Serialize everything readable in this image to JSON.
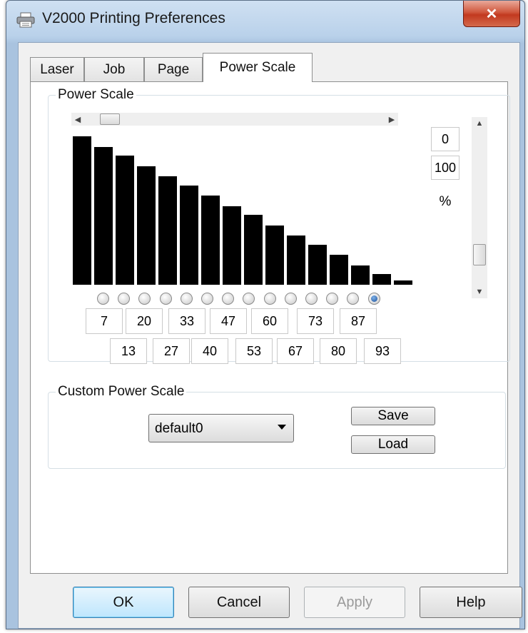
{
  "window": {
    "title": "V2000 Printing Preferences",
    "close_label": "✕"
  },
  "tabs": [
    {
      "label": "Laser"
    },
    {
      "label": "Job"
    },
    {
      "label": "Page"
    },
    {
      "label": "Power Scale",
      "active": true
    }
  ],
  "power_scale": {
    "group_label": "Power Scale",
    "range_min": "0",
    "range_max": "100",
    "unit": "%",
    "bar_levels_percent": [
      100,
      93,
      87,
      80,
      73,
      67,
      60,
      53,
      47,
      40,
      33,
      27,
      20,
      13,
      7,
      3
    ],
    "selected_index": 13,
    "row1_values": [
      "7",
      "20",
      "33",
      "47",
      "60",
      "73",
      "87"
    ],
    "row2_values": [
      "13",
      "27",
      "40",
      "53",
      "67",
      "80",
      "93"
    ]
  },
  "custom_power_scale": {
    "group_label": "Custom Power Scale",
    "selected": "default0",
    "save_label": "Save",
    "load_label": "Load"
  },
  "buttons": {
    "ok": "OK",
    "cancel": "Cancel",
    "apply": "Apply",
    "help": "Help"
  },
  "colors": {
    "close_button": "#c2391f",
    "bars": "#000000",
    "selected_radio": "#1b4f9a"
  }
}
